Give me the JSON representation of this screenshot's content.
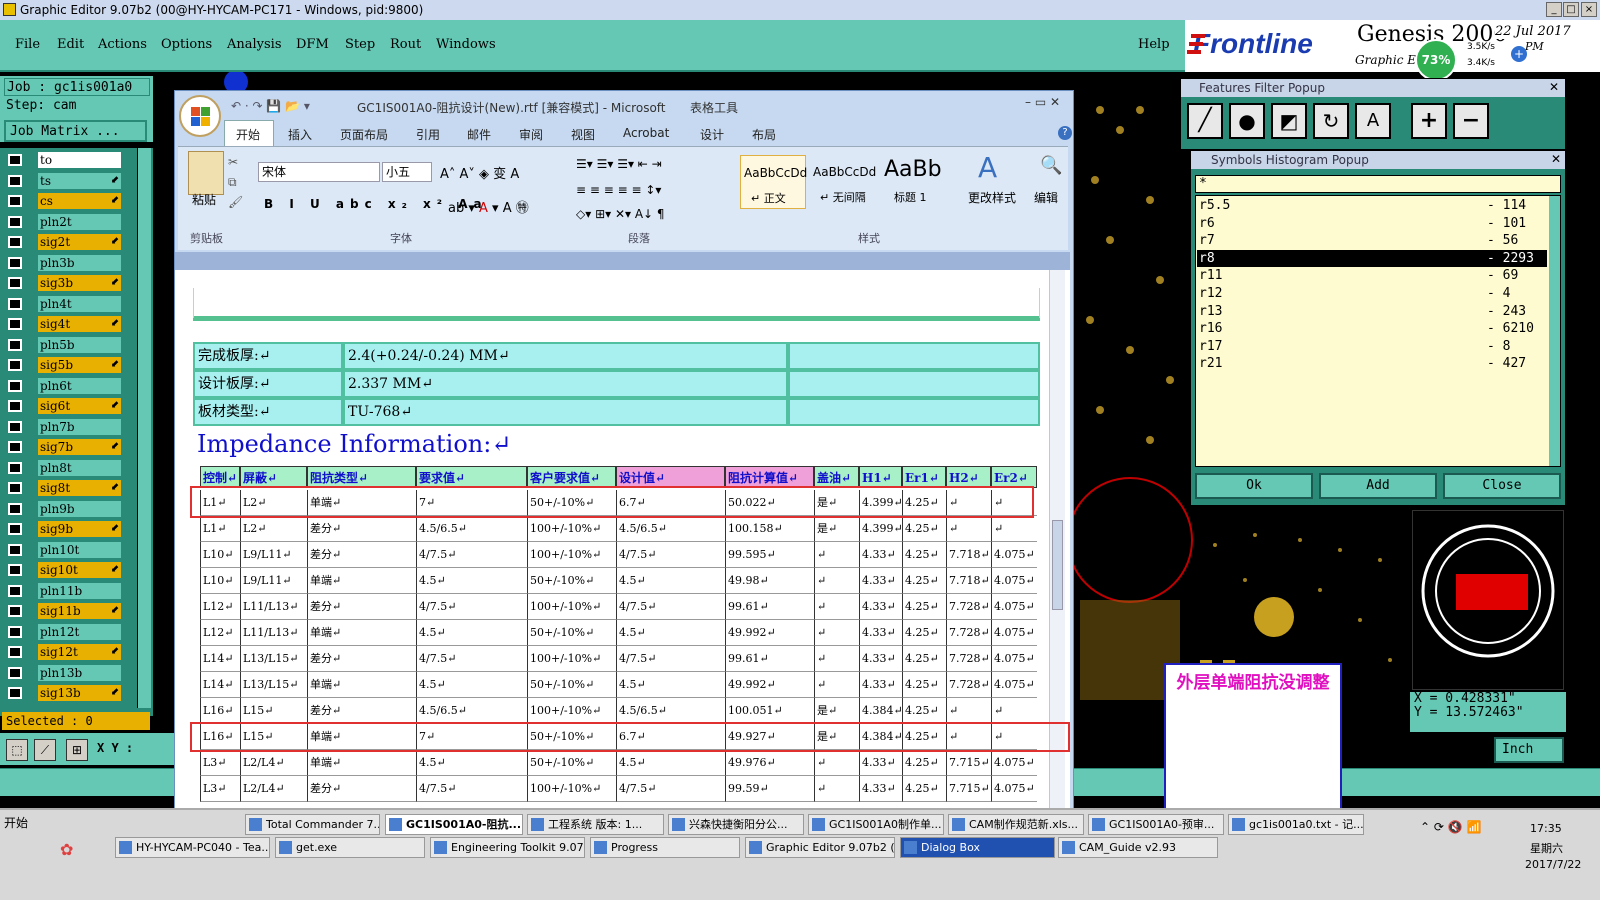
{
  "title_bar": {
    "text": "Graphic Editor 9.07b2 (00@HY-HYCAM-PC171 - Windows, pid:9800)"
  },
  "menu": {
    "items": [
      "File",
      "Edit",
      "Actions",
      "Options",
      "Analysis",
      "DFM",
      "Step",
      "Rout",
      "Windows"
    ],
    "help": "Help"
  },
  "logo": {
    "brand": "Frontline",
    "product": "Genesis 2000",
    "sub": "Graphic Editor",
    "date": "22 Jul 2017",
    "time": "PM",
    "cpu": "73%",
    "net_up": "3.5K/s",
    "net_down": "3.4K/s"
  },
  "job": {
    "job": "Job : gc1is001a0",
    "step": "Step: cam",
    "matrix": "Job Matrix ..."
  },
  "layers": [
    {
      "name": "to",
      "color": "white"
    },
    {
      "name": "ts",
      "color": "mint",
      "arrow": true
    },
    {
      "name": "cs",
      "color": "yellow",
      "arrow": true
    },
    {
      "name": "pln2t",
      "color": "mint"
    },
    {
      "name": "sig2t",
      "color": "yellow",
      "arrow": true
    },
    {
      "name": "pln3b",
      "color": "mint"
    },
    {
      "name": "sig3b",
      "color": "yellow",
      "arrow": true
    },
    {
      "name": "pln4t",
      "color": "mint"
    },
    {
      "name": "sig4t",
      "color": "yellow",
      "arrow": true
    },
    {
      "name": "pln5b",
      "color": "mint"
    },
    {
      "name": "sig5b",
      "color": "yellow",
      "arrow": true
    },
    {
      "name": "pln6t",
      "color": "mint"
    },
    {
      "name": "sig6t",
      "color": "yellow",
      "arrow": true
    },
    {
      "name": "pln7b",
      "color": "mint"
    },
    {
      "name": "sig7b",
      "color": "yellow",
      "arrow": true
    },
    {
      "name": "pln8t",
      "color": "mint"
    },
    {
      "name": "sig8t",
      "color": "yellow",
      "arrow": true
    },
    {
      "name": "pln9b",
      "color": "mint"
    },
    {
      "name": "sig9b",
      "color": "yellow",
      "arrow": true
    },
    {
      "name": "pln10t",
      "color": "mint"
    },
    {
      "name": "sig10t",
      "color": "yellow",
      "arrow": true
    },
    {
      "name": "pln11b",
      "color": "mint"
    },
    {
      "name": "sig11b",
      "color": "yellow",
      "arrow": true
    },
    {
      "name": "pln12t",
      "color": "mint"
    },
    {
      "name": "sig12t",
      "color": "yellow",
      "arrow": true
    },
    {
      "name": "pln13b",
      "color": "mint"
    },
    {
      "name": "sig13b",
      "color": "yellow",
      "arrow": true
    }
  ],
  "status": {
    "selected": "Selected : 0",
    "xy_label": "X Y :",
    "unit": "Inch",
    "coord_x": "X = 0.428331\"",
    "coord_y": "Y = 13.572463\""
  },
  "word": {
    "title": "GC1IS001A0-阻抗设计(New).rtf [兼容模式] - Microsoft ...",
    "context_tab": "表格工具",
    "tabs": [
      "开始",
      "插入",
      "页面布局",
      "引用",
      "邮件",
      "审阅",
      "视图",
      "Acrobat",
      "设计",
      "布局"
    ],
    "font_name": "宋体",
    "font_size": "小五",
    "paste": "粘贴",
    "change_styles": "更改样式",
    "edit": "编辑",
    "styles": [
      {
        "sample": "AaBbCcDd",
        "name": "↵ 正文"
      },
      {
        "sample": "AaBbCcDd",
        "name": "↵ 无间隔"
      },
      {
        "sample": "AaBb",
        "name": "标题 1"
      }
    ],
    "groups": [
      "剪贴板",
      "字体",
      "段落",
      "样式"
    ]
  },
  "doc": {
    "info_rows": [
      {
        "label": "完成板厚:↵",
        "value": "2.4(+0.24/-0.24) MM↵"
      },
      {
        "label": "设计板厚:↵",
        "value": "2.337 MM↵"
      },
      {
        "label": "板材类型:↵",
        "value": "TU-768↵"
      }
    ],
    "heading": "Impedance Information:↵",
    "headers": [
      "控制↵",
      "屏蔽↵",
      "阻抗类型↵",
      "要求值↵",
      "客户要求值↵",
      "设计值↵",
      "阻抗计算值↵",
      "盖油↵",
      "H1↵",
      "Er1↵",
      "H2↵",
      "Er2↵"
    ],
    "rows": [
      [
        "L1↵",
        "L2↵",
        "单端↵",
        "7↵",
        "50+/-10%↵",
        "6.7↵",
        "50.022↵",
        "是↵",
        "4.399↵",
        "4.25↵",
        "↵",
        "↵"
      ],
      [
        "L1↵",
        "L2↵",
        "差分↵",
        "4.5/6.5↵",
        "100+/-10%↵",
        "4.5/6.5↵",
        "100.158↵",
        "是↵",
        "4.399↵",
        "4.25↵",
        "↵",
        "↵"
      ],
      [
        "L10↵",
        "L9/L11↵",
        "差分↵",
        "4/7.5↵",
        "100+/-10%↵",
        "4/7.5↵",
        "99.595↵",
        "↵",
        "4.33↵",
        "4.25↵",
        "7.718↵",
        "4.075↵"
      ],
      [
        "L10↵",
        "L9/L11↵",
        "单端↵",
        "4.5↵",
        "50+/-10%↵",
        "4.5↵",
        "49.98↵",
        "↵",
        "4.33↵",
        "4.25↵",
        "7.718↵",
        "4.075↵"
      ],
      [
        "L12↵",
        "L11/L13↵",
        "差分↵",
        "4/7.5↵",
        "100+/-10%↵",
        "4/7.5↵",
        "99.61↵",
        "↵",
        "4.33↵",
        "4.25↵",
        "7.728↵",
        "4.075↵"
      ],
      [
        "L12↵",
        "L11/L13↵",
        "单端↵",
        "4.5↵",
        "50+/-10%↵",
        "4.5↵",
        "49.992↵",
        "↵",
        "4.33↵",
        "4.25↵",
        "7.728↵",
        "4.075↵"
      ],
      [
        "L14↵",
        "L13/L15↵",
        "差分↵",
        "4/7.5↵",
        "100+/-10%↵",
        "4/7.5↵",
        "99.61↵",
        "↵",
        "4.33↵",
        "4.25↵",
        "7.728↵",
        "4.075↵"
      ],
      [
        "L14↵",
        "L13/L15↵",
        "单端↵",
        "4.5↵",
        "50+/-10%↵",
        "4.5↵",
        "49.992↵",
        "↵",
        "4.33↵",
        "4.25↵",
        "7.728↵",
        "4.075↵"
      ],
      [
        "L16↵",
        "L15↵",
        "差分↵",
        "4.5/6.5↵",
        "100+/-10%↵",
        "4.5/6.5↵",
        "100.051↵",
        "是↵",
        "4.384↵",
        "4.25↵",
        "↵",
        "↵"
      ],
      [
        "L16↵",
        "L15↵",
        "单端↵",
        "7↵",
        "50+/-10%↵",
        "6.7↵",
        "49.927↵",
        "是↵",
        "4.384↵",
        "4.25↵",
        "↵",
        "↵"
      ],
      [
        "L3↵",
        "L2/L4↵",
        "单端↵",
        "4.5↵",
        "50+/-10%↵",
        "4.5↵",
        "49.976↵",
        "↵",
        "4.33↵",
        "4.25↵",
        "7.715↵",
        "4.075↵"
      ],
      [
        "L3↵",
        "L2/L4↵",
        "差分↵",
        "4/7.5↵",
        "100+/-10%↵",
        "4/7.5↵",
        "99.59↵",
        "↵",
        "4.33↵",
        "4.25↵",
        "7.715↵",
        "4.075↵"
      ]
    ]
  },
  "filter_popup": {
    "title": "Features Filter Popup"
  },
  "histogram": {
    "title": "Symbols Histogram Popup",
    "filter": "*",
    "rows": [
      {
        "sym": "r5.5",
        "count": "- 114"
      },
      {
        "sym": "r6",
        "count": "- 101"
      },
      {
        "sym": "r7",
        "count": "- 56"
      },
      {
        "sym": "r8",
        "count": "- 2293",
        "selected": true
      },
      {
        "sym": "r11",
        "count": "- 69"
      },
      {
        "sym": "r12",
        "count": "- 4"
      },
      {
        "sym": "r13",
        "count": "- 243"
      },
      {
        "sym": "r16",
        "count": "- 6210"
      },
      {
        "sym": "r17",
        "count": "- 8"
      },
      {
        "sym": "r21",
        "count": "- 427"
      }
    ],
    "buttons": [
      "Ok",
      "Add",
      "Close"
    ]
  },
  "annotation": {
    "text": "外层单端阻抗没调整"
  },
  "taskbar": {
    "start": "开始",
    "row1": [
      "Total Commander 7....",
      "GC1IS001A0-阻抗...",
      "工程系统 版本: 1...",
      "兴森快捷衡阳分公...",
      "GC1IS001A0制作单...",
      "CAM制作规范新.xls...",
      "GC1IS001A0-预审...",
      "gc1is001a0.txt - 记..."
    ],
    "row2": [
      "HY-HYCAM-PC040 - Tea...",
      "get.exe",
      "Engineering Toolkit 9.07...",
      "Progress",
      "Graphic Editor 9.07b2 (0...",
      "Dialog Box",
      "CAM_Guide v2.93"
    ],
    "time": "17:35",
    "weekday": "星期六",
    "date": "2017/7/22"
  }
}
